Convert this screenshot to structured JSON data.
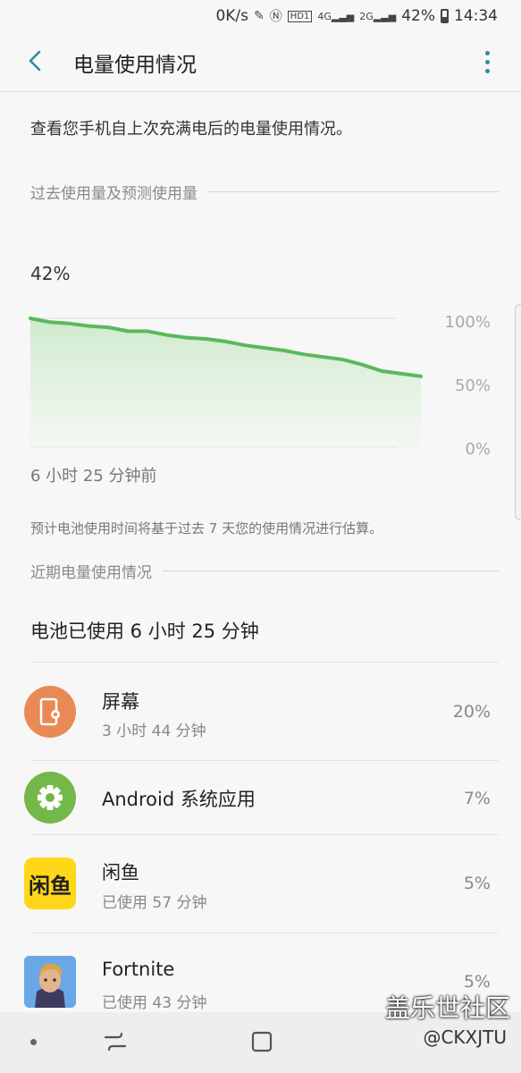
{
  "status_bar": {
    "speed": "0K/s",
    "network_4g": "4G",
    "network_2g": "2G",
    "battery": "42%",
    "time": "14:34",
    "hd_label": "HD1"
  },
  "app_bar": {
    "title": "电量使用情况"
  },
  "intro": "查看您手机自上次充满电后的电量使用情况。",
  "history_section": {
    "title": "过去使用量及预测使用量"
  },
  "chart_data": {
    "type": "area",
    "current_level": "42%",
    "time_label": "6 小时 25 分钟前",
    "ylim": [
      0,
      100
    ],
    "y_ticks": [
      "100%",
      "50%",
      "0%"
    ],
    "x": [
      0,
      1,
      2,
      3,
      4,
      5,
      6,
      7,
      8,
      9,
      10,
      11,
      12,
      13,
      14,
      15,
      16,
      17,
      18,
      19,
      20
    ],
    "values": [
      100,
      97,
      96,
      94,
      93,
      90,
      90,
      87,
      85,
      84,
      82,
      79,
      77,
      75,
      72,
      70,
      68,
      64,
      59,
      57,
      55
    ],
    "color": "#5cb85c"
  },
  "note": "预计电池使用时间将基于过去 7 天您的使用情况进行估算。",
  "recent_section": {
    "title": "近期电量使用情况"
  },
  "summary": "电池已使用 6 小时 25 分钟",
  "apps": [
    {
      "name": "屏幕",
      "sub": "3 小时 44 分钟",
      "pct": "20%",
      "icon": "screen-icon"
    },
    {
      "name": "Android 系统应用",
      "sub": "",
      "pct": "7%",
      "icon": "gear-icon"
    },
    {
      "name": "闲鱼",
      "sub": "已使用 57 分钟",
      "pct": "5%",
      "icon": "xianyu-icon",
      "icon_text": "闲鱼"
    },
    {
      "name": "Fortnite",
      "sub": "已使用 43 分钟",
      "pct": "5%",
      "icon": "fortnite-icon"
    }
  ],
  "watermark": {
    "main": "盖乐世社区",
    "sub": "@CKXJTU"
  }
}
